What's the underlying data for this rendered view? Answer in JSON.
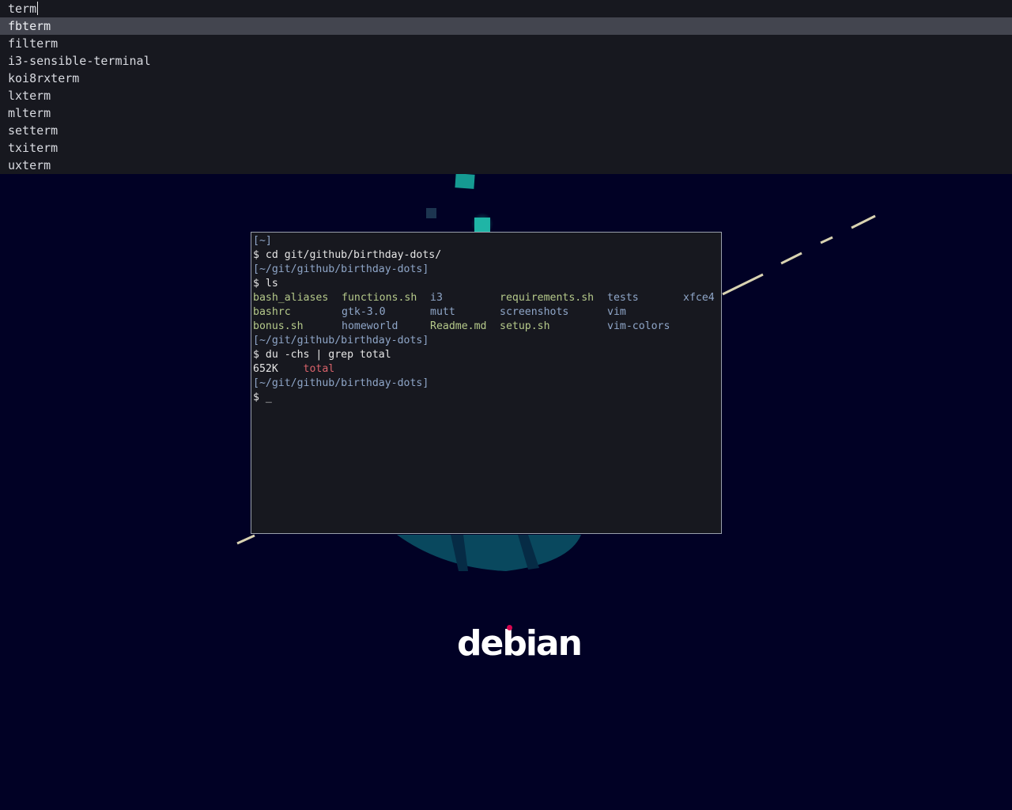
{
  "launcher": {
    "query": "term",
    "items": [
      {
        "label": "fbterm",
        "selected": true
      },
      {
        "label": "filterm",
        "selected": false
      },
      {
        "label": "i3-sensible-terminal",
        "selected": false
      },
      {
        "label": "koi8rxterm",
        "selected": false
      },
      {
        "label": "lxterm",
        "selected": false
      },
      {
        "label": "mlterm",
        "selected": false
      },
      {
        "label": "setterm",
        "selected": false
      },
      {
        "label": "txiterm",
        "selected": false
      },
      {
        "label": "uxterm",
        "selected": false
      }
    ]
  },
  "terminal": {
    "prompt1_dir": "[~]",
    "cmd1": "$ cd git/github/birthday-dots/",
    "prompt2_dir": "[~/git/github/birthday-dots]",
    "cmd2": "$ ls",
    "ls": [
      {
        "name": "bash_aliases",
        "kind": "file"
      },
      {
        "name": "functions.sh",
        "kind": "file"
      },
      {
        "name": "i3",
        "kind": "dir"
      },
      {
        "name": "requirements.sh",
        "kind": "file"
      },
      {
        "name": "tests",
        "kind": "dir"
      },
      {
        "name": "xfce4",
        "kind": "dir"
      },
      {
        "name": "bashrc",
        "kind": "file"
      },
      {
        "name": "gtk-3.0",
        "kind": "dir"
      },
      {
        "name": "mutt",
        "kind": "dir"
      },
      {
        "name": "screenshots",
        "kind": "dir"
      },
      {
        "name": "vim",
        "kind": "dir"
      },
      {
        "name": "",
        "kind": "empty"
      },
      {
        "name": "bonus.sh",
        "kind": "file"
      },
      {
        "name": "homeworld",
        "kind": "dir"
      },
      {
        "name": "Readme.md",
        "kind": "file"
      },
      {
        "name": "setup.sh",
        "kind": "file"
      },
      {
        "name": "vim-colors",
        "kind": "dir"
      },
      {
        "name": "",
        "kind": "empty"
      }
    ],
    "prompt3_dir": "[~/git/github/birthday-dots]",
    "cmd3": "$ du -chs | grep total",
    "out_size": "652K",
    "out_total": "total",
    "prompt4_dir": "[~/git/github/birthday-dots]",
    "cmd4": "$ _"
  },
  "wallpaper": {
    "logo_text": "debian"
  },
  "colors": {
    "background": "#010125",
    "accent_teal": "#1fb5a6",
    "debian_red": "#d70751",
    "file_green": "#b5c98a",
    "dir_blue": "#8fa6c8",
    "total_red": "#d9626a"
  }
}
